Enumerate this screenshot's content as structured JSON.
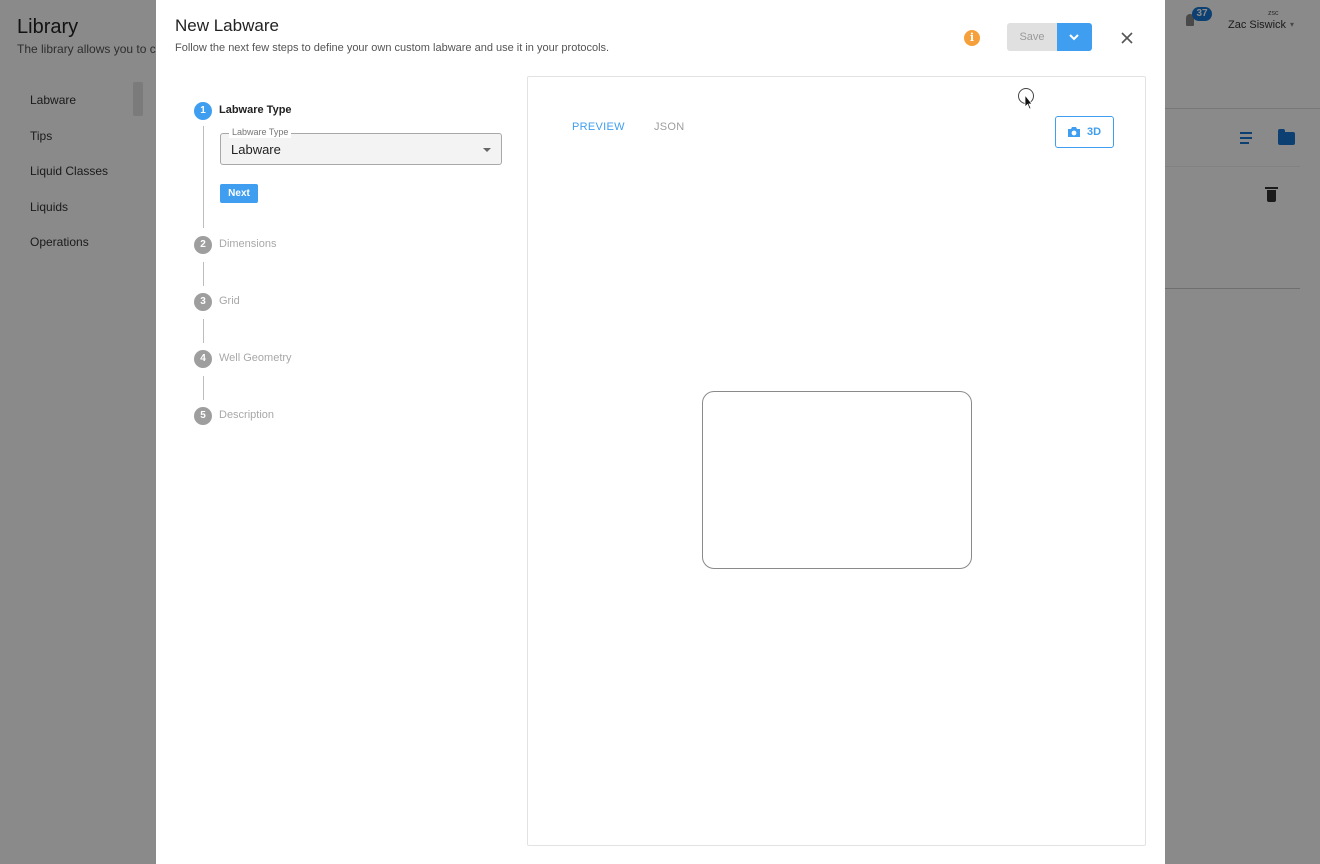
{
  "background": {
    "title": "Library",
    "subtitle": "The library allows you to con",
    "nav": [
      "Labware",
      "Tips",
      "Liquid Classes",
      "Liquids",
      "Operations"
    ],
    "notification_count": "37",
    "user_small": "zsc",
    "user_name": "Zac Siswick"
  },
  "dialog": {
    "title": "New Labware",
    "subtitle": "Follow the next few steps to define your own custom labware and use it in your protocols.",
    "info_icon": "i",
    "save_label": "Save",
    "steps": [
      {
        "number": "1",
        "label": "Labware Type",
        "active": true
      },
      {
        "number": "2",
        "label": "Dimensions",
        "active": false
      },
      {
        "number": "3",
        "label": "Grid",
        "active": false
      },
      {
        "number": "4",
        "label": "Well Geometry",
        "active": false
      },
      {
        "number": "5",
        "label": "Description",
        "active": false
      }
    ],
    "labware_type": {
      "legend": "Labware Type",
      "value": "Labware"
    },
    "next_label": "Next",
    "tabs": [
      {
        "label": "PREVIEW",
        "active": true
      },
      {
        "label": "JSON",
        "active": false
      }
    ],
    "view_3d_label": "3D"
  },
  "colors": {
    "accent": "#3f9ef0",
    "info": "#f5a03a",
    "inactive_step": "#9e9e9e"
  },
  "icons": [
    "info-icon",
    "chevron-down-icon",
    "close-icon",
    "camera-icon",
    "cursor-icon"
  ]
}
